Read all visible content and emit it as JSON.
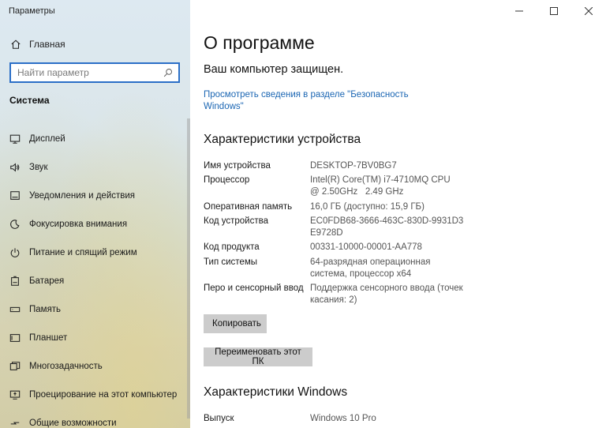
{
  "window": {
    "title": "Параметры"
  },
  "sidebar": {
    "home_label": "Главная",
    "search_placeholder": "Найти параметр",
    "section_title": "Система",
    "items": [
      {
        "label": "Дисплей",
        "icon": "display-icon"
      },
      {
        "label": "Звук",
        "icon": "sound-icon"
      },
      {
        "label": "Уведомления и действия",
        "icon": "notifications-icon"
      },
      {
        "label": "Фокусировка внимания",
        "icon": "focus-assist-icon"
      },
      {
        "label": "Питание и спящий режим",
        "icon": "power-icon"
      },
      {
        "label": "Батарея",
        "icon": "battery-icon"
      },
      {
        "label": "Память",
        "icon": "storage-icon"
      },
      {
        "label": "Планшет",
        "icon": "tablet-icon"
      },
      {
        "label": "Многозадачность",
        "icon": "multitasking-icon"
      },
      {
        "label": "Проецирование на этот компьютер",
        "icon": "projecting-icon"
      },
      {
        "label": "Общие возможности",
        "icon": "shared-experiences-icon"
      }
    ]
  },
  "main": {
    "title": "О программе",
    "protected_text": "Ваш компьютер защищен.",
    "security_link": "Просмотреть сведения в разделе \"Безопасность Windows\"",
    "device_specs": {
      "heading": "Характеристики устройства",
      "rows": [
        {
          "key": "Имя устройства",
          "value": "DESKTOP-7BV0BG7"
        },
        {
          "key": "Процессор",
          "value": "Intel(R) Core(TM) i7-4710MQ CPU @ 2.50GHz   2.49 GHz"
        },
        {
          "key": "Оперативная память",
          "value": "16,0 ГБ (доступно: 15,9 ГБ)"
        },
        {
          "key": "Код устройства",
          "value": "EC0FDB68-3666-463C-830D-9931D3E9728D"
        },
        {
          "key": "Код продукта",
          "value": "00331-10000-00001-AA778"
        },
        {
          "key": "Тип системы",
          "value": "64-разрядная операционная система, процессор x64"
        },
        {
          "key": "Перо и сенсорный ввод",
          "value": "Поддержка сенсорного ввода (точек касания: 2)"
        }
      ],
      "copy_button": "Копировать",
      "rename_button": "Переименовать этот ПК"
    },
    "windows_specs": {
      "heading": "Характеристики Windows",
      "rows": [
        {
          "key": "Выпуск",
          "value": "Windows 10 Pro"
        }
      ]
    }
  },
  "colors": {
    "accent": "#1b66b3",
    "search_border": "#2b6fc7",
    "button_bg": "#cccccc"
  }
}
